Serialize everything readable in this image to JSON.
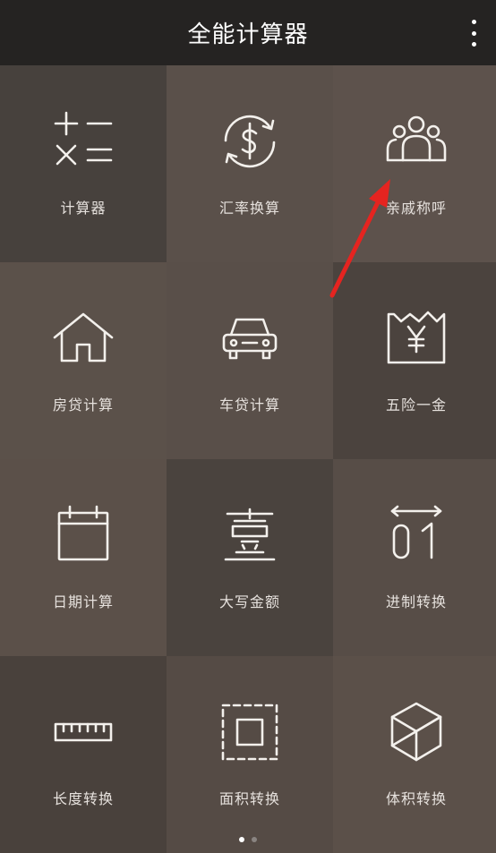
{
  "header": {
    "title": "全能计算器",
    "menu_icon": "more-vertical-icon"
  },
  "tools": [
    {
      "label": "计算器",
      "icon": "calculator-icon",
      "bg": "#47413d"
    },
    {
      "label": "汇率换算",
      "icon": "currency-exchange-icon",
      "bg": "#5a504a"
    },
    {
      "label": "亲戚称呼",
      "icon": "people-group-icon",
      "bg": "#5d524c"
    },
    {
      "label": "房贷计算",
      "icon": "house-icon",
      "bg": "#5b514a"
    },
    {
      "label": "车贷计算",
      "icon": "car-icon",
      "bg": "#594f49"
    },
    {
      "label": "五险一金",
      "icon": "yuan-document-icon",
      "bg": "#4b433e"
    },
    {
      "label": "日期计算",
      "icon": "calendar-icon",
      "bg": "#5b5049"
    },
    {
      "label": "大写金额",
      "icon": "uppercase-number-icon",
      "bg": "#4a433e"
    },
    {
      "label": "进制转换",
      "icon": "base-conversion-icon",
      "bg": "#574d47"
    },
    {
      "label": "长度转换",
      "icon": "ruler-icon",
      "bg": "#49413c"
    },
    {
      "label": "面积转换",
      "icon": "area-square-icon",
      "bg": "#554b45"
    },
    {
      "label": "体积转换",
      "icon": "cube-icon",
      "bg": "#5b5049"
    }
  ],
  "pager": {
    "total": 2,
    "current": 1,
    "active_color": "#ffffff",
    "inactive_color": "#8a8481"
  },
  "annotation": {
    "color": "#e52420"
  }
}
